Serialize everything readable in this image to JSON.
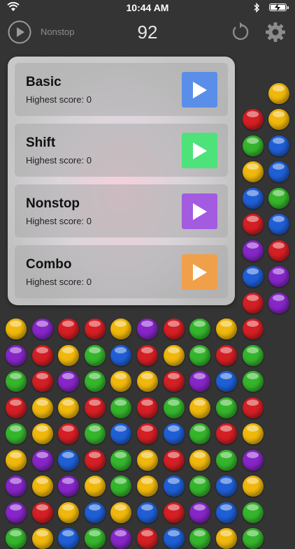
{
  "status_bar": {
    "time": "10:44 AM"
  },
  "toolbar": {
    "mode_label": "Nonstop",
    "score": "92"
  },
  "menu": {
    "modes": [
      {
        "title": "Basic",
        "subtitle": "Highest score: 0",
        "color": "#5b8ee8"
      },
      {
        "title": "Shift",
        "subtitle": "Highest score: 0",
        "color": "#4de27a"
      },
      {
        "title": "Nonstop",
        "subtitle": "Highest score: 0",
        "color": "#a35be0"
      },
      {
        "title": "Combo",
        "subtitle": "Highest score: 0",
        "color": "#f0a04a"
      }
    ]
  },
  "colors": {
    "R": "#d41f24",
    "Y": "#f0b80c",
    "G": "#35b52c",
    "B": "#1f5fd6",
    "P": "#8626c8"
  },
  "board": [
    "PYGB",
    "Y",
    "RYG",
    "GB",
    "YBG",
    "BGY",
    "RBP",
    "PRB",
    "BPR",
    "RPB",
    "YPRRYPRGYR",
    "PRYGBRYGRG",
    "GRPGYYRPBG",
    "RYYRGRGYGR",
    "GYRGBRBGRY",
    "YPBRGYRYGP",
    "PYPYGYBGBY",
    "PRYBYBRPBG",
    "GYBGPRBGYG"
  ]
}
